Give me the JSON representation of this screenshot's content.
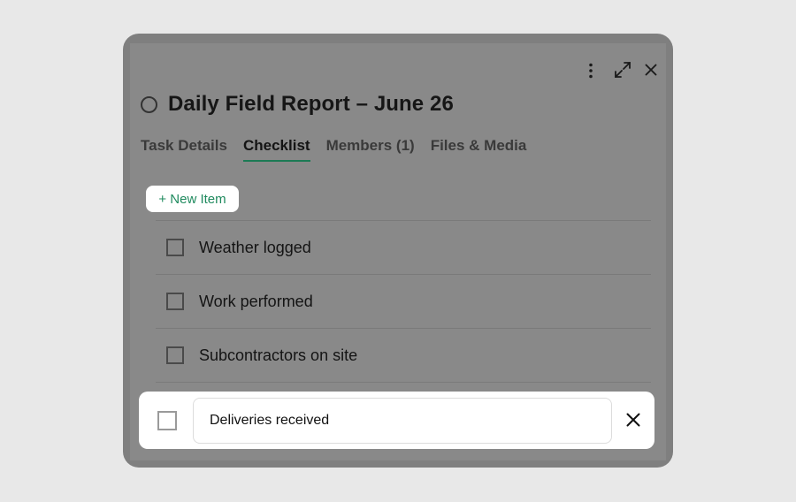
{
  "task": {
    "title": "Daily Field Report – June 26"
  },
  "tabs": [
    {
      "label": "Task Details",
      "active": false
    },
    {
      "label": "Checklist",
      "active": true
    },
    {
      "label": "Members (1)",
      "active": false
    },
    {
      "label": "Files & Media",
      "active": false
    }
  ],
  "toolbar": {
    "icons": [
      "more-vertical-icon",
      "expand-icon",
      "close-icon"
    ]
  },
  "checklist": {
    "new_item_label": "+ New Item",
    "items": [
      {
        "label": "Weather logged",
        "checked": false
      },
      {
        "label": "Work performed",
        "checked": false
      },
      {
        "label": "Subcontractors on site",
        "checked": false
      }
    ],
    "editing_item": {
      "value": "Deliveries received",
      "checked": false
    }
  },
  "colors": {
    "accent": "#1f8a5e",
    "overlay": "#898989",
    "background": "#e8e8e8"
  }
}
